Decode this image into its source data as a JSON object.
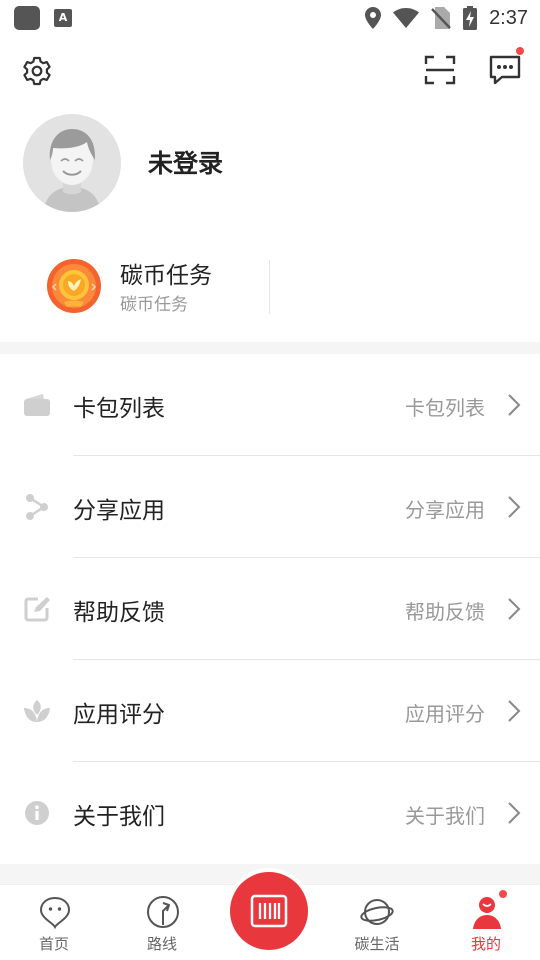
{
  "status_bar": {
    "time": "2:37",
    "notification_icon": "A"
  },
  "header": {
    "settings_icon": "gear-icon",
    "scan_icon": "scan-icon",
    "message_icon": "message-icon"
  },
  "profile": {
    "username": "未登录"
  },
  "task_card": {
    "title": "碳币任务",
    "subtitle": "碳币任务"
  },
  "menu": [
    {
      "icon": "wallet-icon",
      "label": "卡包列表",
      "value": "卡包列表"
    },
    {
      "icon": "share-icon",
      "label": "分享应用",
      "value": "分享应用"
    },
    {
      "icon": "edit-icon",
      "label": "帮助反馈",
      "value": "帮助反馈"
    },
    {
      "icon": "leaf-icon",
      "label": "应用评分",
      "value": "应用评分"
    },
    {
      "icon": "info-icon",
      "label": "关于我们",
      "value": "关于我们"
    }
  ],
  "tabs": [
    {
      "label": "首页",
      "icon": "home-pin-icon"
    },
    {
      "label": "路线",
      "icon": "route-icon"
    },
    {
      "label": "碳生活",
      "icon": "planet-icon"
    },
    {
      "label": "我的",
      "icon": "user-icon",
      "active": true
    }
  ],
  "colors": {
    "accent": "#e8383d",
    "dot": "#f04a4a",
    "muted": "#999999",
    "icon_gray": "#cccccc"
  }
}
